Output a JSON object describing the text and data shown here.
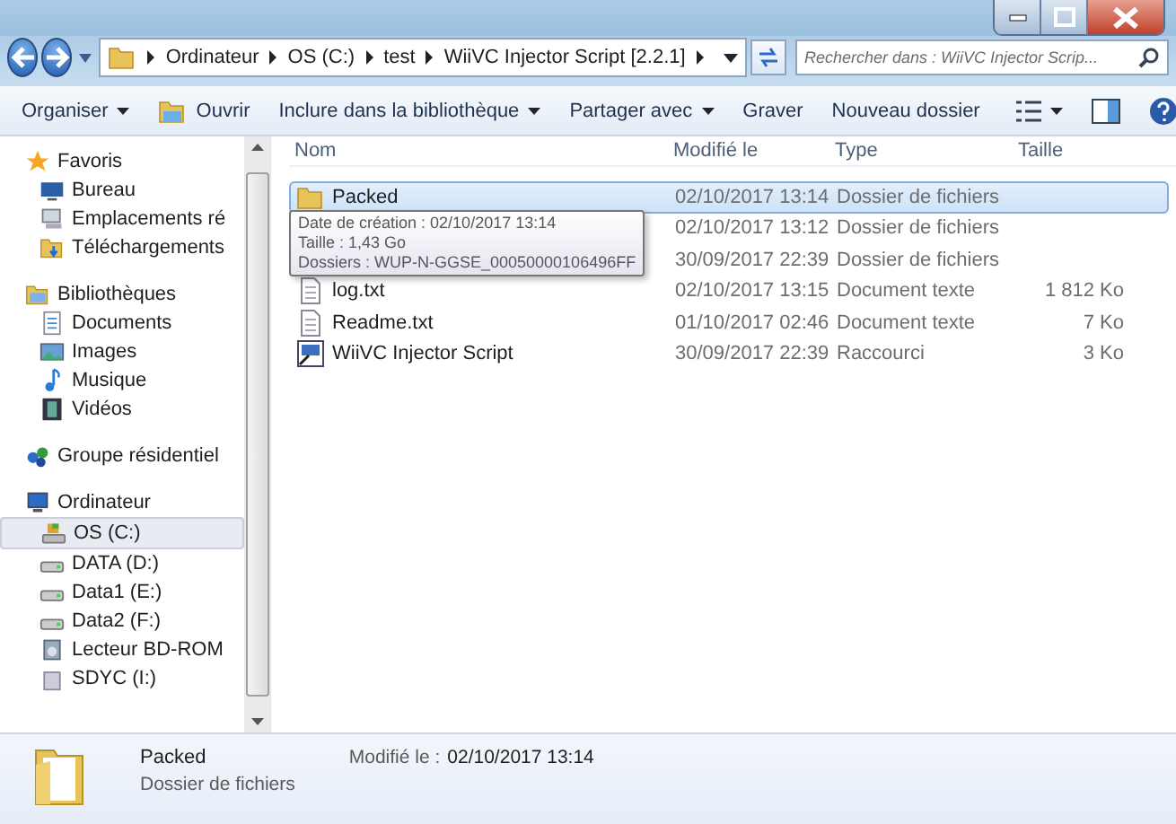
{
  "address_bar": {
    "crumbs": [
      "Ordinateur",
      "OS (C:)",
      "test",
      "WiiVC Injector Script [2.2.1]"
    ]
  },
  "search": {
    "placeholder": "Rechercher dans : WiiVC Injector Scrip..."
  },
  "toolbar": {
    "items": [
      {
        "label": "Organiser",
        "dropdown": true,
        "icon": false
      },
      {
        "label": "Ouvrir",
        "dropdown": false,
        "icon": true
      },
      {
        "label": "Inclure dans la bibliothèque",
        "dropdown": true,
        "icon": false
      },
      {
        "label": "Partager avec",
        "dropdown": true,
        "icon": false
      },
      {
        "label": "Graver",
        "dropdown": false,
        "icon": false
      },
      {
        "label": "Nouveau dossier",
        "dropdown": false,
        "icon": false
      }
    ]
  },
  "sidebar": {
    "groups": [
      {
        "label": "Favoris",
        "kind": "star",
        "items": [
          {
            "label": "Bureau",
            "kind": "desktop",
            "selected": false
          },
          {
            "label": "Emplacements ré",
            "kind": "places",
            "selected": false
          },
          {
            "label": "Téléchargements",
            "kind": "download",
            "selected": false
          }
        ]
      },
      {
        "label": "Bibliothèques",
        "kind": "library",
        "items": [
          {
            "label": "Documents",
            "kind": "doc",
            "selected": false
          },
          {
            "label": "Images",
            "kind": "image",
            "selected": false
          },
          {
            "label": "Musique",
            "kind": "music",
            "selected": false
          },
          {
            "label": "Vidéos",
            "kind": "video",
            "selected": false
          }
        ]
      },
      {
        "label": "Groupe résidentiel",
        "kind": "homegroup"
      },
      {
        "label": "Ordinateur",
        "kind": "computer",
        "items": [
          {
            "label": "OS (C:)",
            "kind": "osdrive",
            "selected": true
          },
          {
            "label": "DATA (D:)",
            "kind": "drive",
            "selected": false
          },
          {
            "label": "Data1 (E:)",
            "kind": "drive",
            "selected": false
          },
          {
            "label": "Data2 (F:)",
            "kind": "drive",
            "selected": false
          },
          {
            "label": "Lecteur BD-ROM",
            "kind": "disc",
            "selected": false
          },
          {
            "label": "SDYC (I:)",
            "kind": "card",
            "selected": false
          }
        ]
      }
    ]
  },
  "table": {
    "columns": [
      "Nom",
      "Modifié le",
      "Type",
      "Taille"
    ],
    "rows": [
      {
        "kind": "folder",
        "name": "Packed",
        "modified": "02/10/2017 13:14",
        "type": "Dossier de fichiers",
        "selected": true
      },
      {
        "kind": "folder",
        "modified": "02/10/2017 13:12",
        "type": "Dossier de fichiers",
        "selected": false
      },
      {
        "kind": "folder",
        "modified": "30/09/2017 22:39",
        "type": "Dossier de fichiers",
        "selected": false
      },
      {
        "kind": "text",
        "name": "log.txt",
        "modified": "02/10/2017 13:15",
        "type": "Document texte",
        "size": "1 812 Ko",
        "selected": false
      },
      {
        "kind": "text",
        "name": "Readme.txt",
        "modified": "01/10/2017 02:46",
        "type": "Document texte",
        "size": "7 Ko",
        "selected": false
      },
      {
        "kind": "shortcut",
        "name": "WiiVC Injector Script",
        "modified": "30/09/2017 22:39",
        "type": "Raccourci",
        "size": "3 Ko",
        "selected": false
      }
    ]
  },
  "tooltip": {
    "lines": [
      "Date de création : 02/10/2017 13:14",
      "Taille : 1,43 Go",
      "Dossiers : WUP-N-GGSE_00050000106496FF"
    ]
  },
  "details": {
    "name": "Packed",
    "type": "Dossier de fichiers",
    "modified_label": "Modifié le :",
    "modified": "02/10/2017 13:14"
  }
}
